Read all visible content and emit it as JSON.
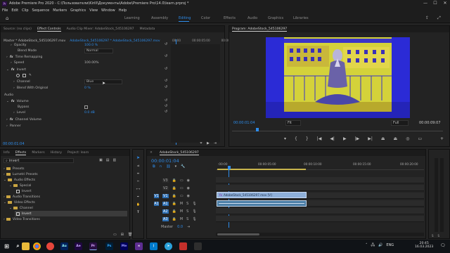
{
  "window": {
    "title": "Adobe Premiere Pro 2020 - C:\\Пользователи\\Kirill\\Документы\\Adobe\\Premiere Pro\\14.0\\learn.prproj *",
    "app_abbr": "Pr"
  },
  "menu": [
    "File",
    "Edit",
    "Clip",
    "Sequence",
    "Markers",
    "Graphics",
    "View",
    "Window",
    "Help"
  ],
  "workspaces": {
    "tabs": [
      "Learning",
      "Assembly",
      "Editing",
      "Color",
      "Effects",
      "Audio",
      "Graphics",
      "Libraries"
    ],
    "active": "Editing"
  },
  "effect_controls": {
    "tabs": [
      "Source: (no clips)",
      "Effect Controls",
      "Audio Clip Mixer: AdobeStock_545106297",
      "Metadata"
    ],
    "active_tab": "Effect Controls",
    "clip_path": "Master * AdobeStock_545106297.mov",
    "clip_link": "AdobeStock_545106297 * AdobeStock_545106297.mov",
    "ruler_times": [
      "00:00",
      "00:00:05:00",
      "00:00:1"
    ],
    "rows": [
      {
        "label": "Opacity",
        "value": "100.0 %"
      },
      {
        "label": "Blend Mode",
        "value": "Normal"
      },
      {
        "label": "Time Remapping",
        "value": ""
      },
      {
        "label": "Speed",
        "value": "100.00%"
      },
      {
        "label": "Invert",
        "value": ""
      },
      {
        "label": "Channel",
        "value": "Blue"
      },
      {
        "label": "Blend With Original",
        "value": "0 %"
      },
      {
        "label": "Audio",
        "value": ""
      },
      {
        "label": "Volume",
        "value": ""
      },
      {
        "label": "Bypass",
        "value": ""
      },
      {
        "label": "Level",
        "value": "0.0 dB"
      },
      {
        "label": "Channel Volume",
        "value": ""
      },
      {
        "label": "Panner",
        "value": ""
      }
    ],
    "fx_label": "fx",
    "timecode": "00:00:01:04"
  },
  "program_monitor": {
    "title": "Program: AdobeStock_545106297",
    "timecode": "00:00:01:04",
    "fit": "Fit",
    "quality": "Full",
    "duration": "00:00:09:07"
  },
  "project_panel": {
    "tabs": [
      "Info",
      "Effects",
      "Markers",
      "History",
      "Project: learn"
    ],
    "active_tab": "Effects",
    "search_value": "invert",
    "tree": [
      {
        "label": "Presets",
        "type": "folder",
        "indent": 0
      },
      {
        "label": "Lumetri Presets",
        "type": "folder",
        "indent": 0
      },
      {
        "label": "Audio Effects",
        "type": "folder",
        "indent": 0
      },
      {
        "label": "Special",
        "type": "folder",
        "indent": 1
      },
      {
        "label": "Invert",
        "type": "file",
        "indent": 2
      },
      {
        "label": "Audio Transitions",
        "type": "folder",
        "indent": 0
      },
      {
        "label": "Video Effects",
        "type": "folder",
        "indent": 0
      },
      {
        "label": "Channel",
        "type": "folder",
        "indent": 1
      },
      {
        "label": "Invert",
        "type": "file",
        "indent": 2,
        "selected": true
      },
      {
        "label": "Video Transitions",
        "type": "folder",
        "indent": 0
      }
    ]
  },
  "timeline": {
    "tab": "AdobeStock_545106297",
    "timecode": "00:00:01:04",
    "ruler": [
      ":00:00",
      "00:00:05:00",
      "00:00:10:00",
      "00:00:15:00",
      "00:00:20:00"
    ],
    "tracks": [
      "V3",
      "V2",
      "V1",
      "A1",
      "A2",
      "A3"
    ],
    "master_label": "Master",
    "master_value": "0.0",
    "video_clip": "AdobeStock_545106297.mov [V]",
    "playhead_fraction": 0.06
  },
  "tools": [
    "selection",
    "track-select",
    "ripple",
    "razor",
    "slip",
    "pen",
    "hand",
    "type"
  ],
  "taskbar": {
    "apps": [
      "windows",
      "search",
      "file-explorer",
      "chrome",
      "yandex",
      "audition",
      "after-effects",
      "premiere",
      "photoshop",
      "media-encoder",
      "visual-studio",
      "visual-studio-code",
      "telegram",
      "app-red",
      "app-dark"
    ],
    "app_abbr": [
      "Au",
      "Ae",
      "Pr",
      "Ps",
      "Me"
    ],
    "lang": "ENG",
    "time": "20:45",
    "date": "16.03.2023"
  },
  "colors": {
    "accent": "#2d8ceb",
    "playhead": "#2d8ceb",
    "video_clip": "#8fb0d9",
    "audio_clip": "#4b7ea6",
    "work_area": "#c9b54c"
  }
}
